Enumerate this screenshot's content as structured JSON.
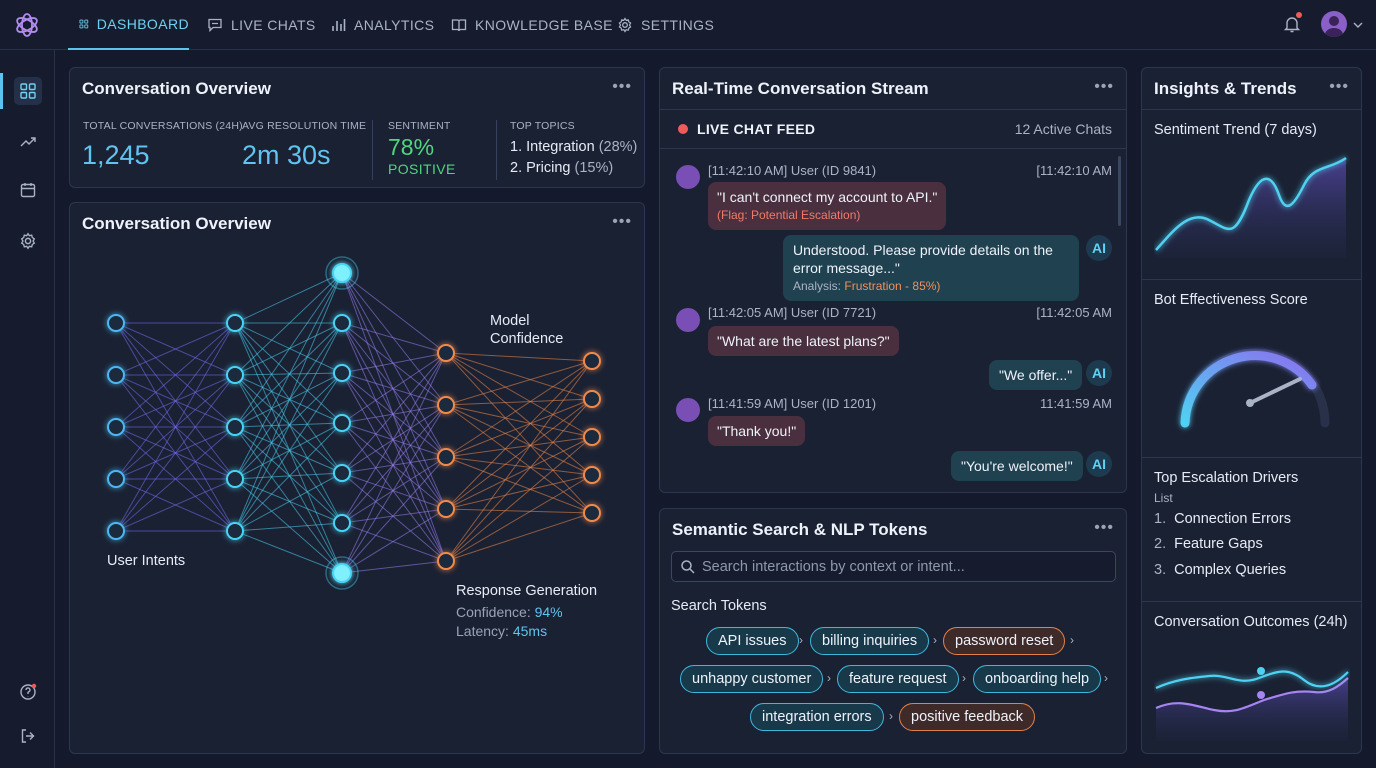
{
  "nav": {
    "tabs": [
      {
        "label": "DASHBOARD",
        "icon": "grid-icon"
      },
      {
        "label": "LIVE CHATS",
        "icon": "chat-icon"
      },
      {
        "label": "ANALYTICS",
        "icon": "bar-chart-icon"
      },
      {
        "label": "KNOWLEDGE BASE",
        "icon": "book-icon"
      },
      {
        "label": "SETTINGS",
        "icon": "gear-icon"
      }
    ],
    "active_tab": "DASHBOARD",
    "accent": "#5cc2ee",
    "notification_dot_color": "#ef5a5a"
  },
  "sidebar": {
    "icons": [
      "grid-icon",
      "trend-icon",
      "calendar-icon",
      "gear-icon",
      "help-icon",
      "logout-icon"
    ],
    "active": "grid-icon"
  },
  "overview": {
    "title": "Conversation Overview",
    "stats": [
      {
        "label": "TOTAL CONVERSATIONS (24H)",
        "value": "1,245"
      },
      {
        "label": "AVG RESOLUTION TIME",
        "value": "2m 30s"
      }
    ],
    "sentiment": {
      "label": "SENTIMENT",
      "value": "78%",
      "text": "POSITIVE",
      "color": "#4fd67e"
    },
    "topics": {
      "label": "TOP TOPICS",
      "items": [
        {
          "name": "1. Integration",
          "pct": "(28%)"
        },
        {
          "name": "2. Pricing",
          "pct": "(15%)"
        }
      ]
    }
  },
  "network": {
    "title": "Conversation Overview",
    "input_label": "User Intents",
    "confidence_label_1": "Model",
    "confidence_label_2": "Confidence",
    "output_label": "Response Generation",
    "confidence_text": "Confidence:",
    "confidence_value": "94%",
    "latency_text": "Latency:",
    "latency_value": "45ms",
    "layers": [
      5,
      5,
      7,
      5,
      5
    ],
    "colors": {
      "input": "#4bb8f2",
      "hidden": "#49d3f5",
      "output": "#f08a4b"
    }
  },
  "stream": {
    "title": "Real-Time Conversation Stream",
    "feed_title": "LIVE CHAT FEED",
    "active_count": "12 Active Chats",
    "messages": [
      {
        "meta": "[11:42:10 AM] User (ID 9841)",
        "time": "[11:42:10 AM",
        "text": "\"I can't connect my account to API.\"",
        "flag": "(Flag: Potential Escalation)",
        "reply1": "Understood. Please provide details on the",
        "reply2": "error message...\"",
        "analysis": "Analysis:",
        "analysis_value": "Frustration - 85%)"
      },
      {
        "meta": "[11:42:05 AM] User (ID 7721)",
        "time": "[11:42:05 AM",
        "text": "\"What are the latest plans?\"",
        "reply": "\"We offer...\""
      },
      {
        "meta": "[11:41:59 AM] User (ID 1201)",
        "time": "11:41:59 AM",
        "text": "\"Thank you!\"",
        "reply": "\"You're welcome!\""
      }
    ],
    "ai_label": "AI"
  },
  "search": {
    "title": "Semantic Search & NLP Tokens",
    "placeholder": "Search interactions by context or intent...",
    "tokens_label": "Search Tokens",
    "tokens": [
      {
        "label": "API issues",
        "tone": "cyan"
      },
      {
        "label": "billing inquiries",
        "tone": "cyan"
      },
      {
        "label": "password reset",
        "tone": "orange"
      },
      {
        "label": "unhappy customer",
        "tone": "cyan"
      },
      {
        "label": "feature request",
        "tone": "cyan"
      },
      {
        "label": "onboarding help",
        "tone": "cyan"
      },
      {
        "label": "integration errors",
        "tone": "cyan"
      },
      {
        "label": "positive feedback",
        "tone": "orange"
      }
    ]
  },
  "insights": {
    "title": "Insights & Trends",
    "sentiment_trend": "Sentiment Trend (7 days)",
    "bot_score": "Bot Effectiveness Score",
    "escalation_title": "Top Escalation Drivers",
    "escalation_sub": "List",
    "escalation_items": [
      {
        "num": "1.",
        "label": "Connection Errors"
      },
      {
        "num": "2.",
        "label": "Feature Gaps"
      },
      {
        "num": "3.",
        "label": "Complex Queries"
      }
    ],
    "outcomes_title": "Conversation Outcomes (24h)"
  }
}
